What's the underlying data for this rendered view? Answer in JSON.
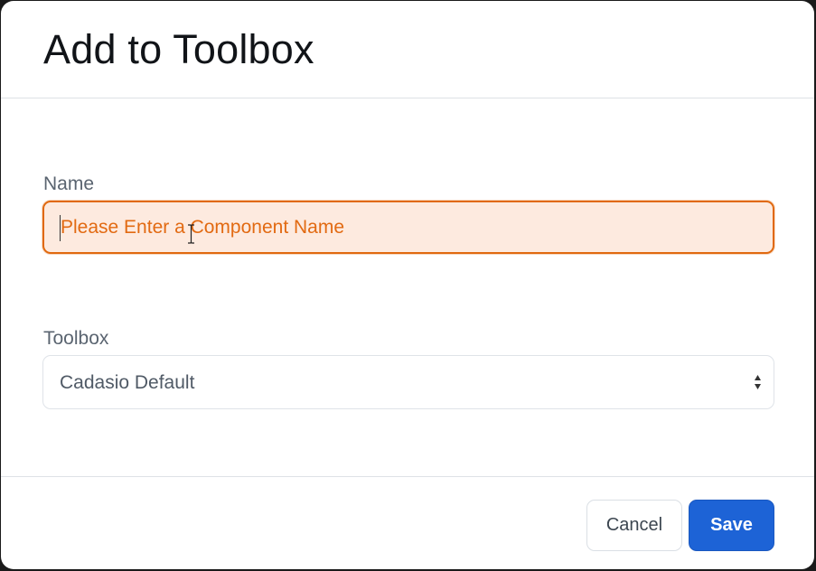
{
  "dialog": {
    "title": "Add to Toolbox"
  },
  "form": {
    "name_label": "Name",
    "name_placeholder": "Please Enter a Component Name",
    "name_value": "",
    "toolbox_label": "Toolbox",
    "toolbox_selected": "Cadasio Default"
  },
  "footer": {
    "cancel_label": "Cancel",
    "save_label": "Save"
  },
  "colors": {
    "input_focus_border": "#e0690f",
    "input_focus_bg": "#fdeadf",
    "primary": "#1d63d6"
  },
  "icons": {
    "select_arrows": "up-down-chevron-icon",
    "cursor": "text-ibeam-cursor-icon"
  }
}
